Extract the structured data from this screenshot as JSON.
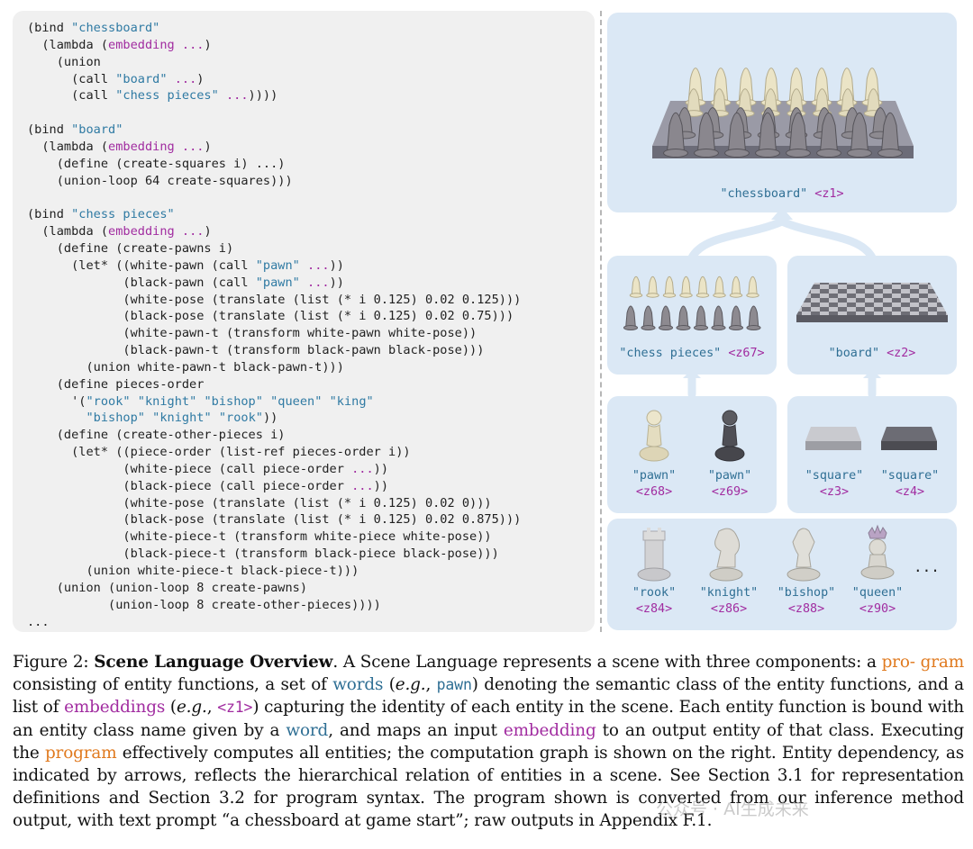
{
  "code": {
    "lines": [
      [
        {
          "t": "(bind "
        },
        {
          "t": "\"chessboard\"",
          "c": "word"
        }
      ],
      [
        {
          "t": "  (lambda ("
        },
        {
          "t": "embedding",
          "c": "emb"
        },
        {
          "t": " "
        },
        {
          "t": "...",
          "c": "emb"
        },
        {
          "t": ")"
        }
      ],
      [
        {
          "t": "    (union"
        }
      ],
      [
        {
          "t": "      (call "
        },
        {
          "t": "\"board\"",
          "c": "word"
        },
        {
          "t": " "
        },
        {
          "t": "...",
          "c": "emb"
        },
        {
          "t": ")"
        }
      ],
      [
        {
          "t": "      (call "
        },
        {
          "t": "\"chess pieces\"",
          "c": "word"
        },
        {
          "t": " "
        },
        {
          "t": "...",
          "c": "emb"
        },
        {
          "t": "))))"
        }
      ],
      [
        {
          "t": ""
        }
      ],
      [
        {
          "t": "(bind "
        },
        {
          "t": "\"board\"",
          "c": "word"
        }
      ],
      [
        {
          "t": "  (lambda ("
        },
        {
          "t": "embedding",
          "c": "emb"
        },
        {
          "t": " "
        },
        {
          "t": "...",
          "c": "emb"
        },
        {
          "t": ")"
        }
      ],
      [
        {
          "t": "    (define (create-squares i) ...)"
        }
      ],
      [
        {
          "t": "    (union-loop 64 create-squares)))"
        }
      ],
      [
        {
          "t": ""
        }
      ],
      [
        {
          "t": "(bind "
        },
        {
          "t": "\"chess pieces\"",
          "c": "word"
        }
      ],
      [
        {
          "t": "  (lambda ("
        },
        {
          "t": "embedding",
          "c": "emb"
        },
        {
          "t": " "
        },
        {
          "t": "...",
          "c": "emb"
        },
        {
          "t": ")"
        }
      ],
      [
        {
          "t": "    (define (create-pawns i)"
        }
      ],
      [
        {
          "t": "      (let* ((white-pawn (call "
        },
        {
          "t": "\"pawn\"",
          "c": "word"
        },
        {
          "t": " "
        },
        {
          "t": "...",
          "c": "emb"
        },
        {
          "t": "))"
        }
      ],
      [
        {
          "t": "             (black-pawn (call "
        },
        {
          "t": "\"pawn\"",
          "c": "word"
        },
        {
          "t": " "
        },
        {
          "t": "...",
          "c": "emb"
        },
        {
          "t": "))"
        }
      ],
      [
        {
          "t": "             (white-pose (translate (list (* i 0.125) 0.02 0.125)))"
        }
      ],
      [
        {
          "t": "             (black-pose (translate (list (* i 0.125) 0.02 0.75)))"
        }
      ],
      [
        {
          "t": "             (white-pawn-t (transform white-pawn white-pose))"
        }
      ],
      [
        {
          "t": "             (black-pawn-t (transform black-pawn black-pose)))"
        }
      ],
      [
        {
          "t": "        (union white-pawn-t black-pawn-t)))"
        }
      ],
      [
        {
          "t": "    (define pieces-order"
        }
      ],
      [
        {
          "t": "      '("
        },
        {
          "t": "\"rook\"",
          "c": "word"
        },
        {
          "t": " "
        },
        {
          "t": "\"knight\"",
          "c": "word"
        },
        {
          "t": " "
        },
        {
          "t": "\"bishop\"",
          "c": "word"
        },
        {
          "t": " "
        },
        {
          "t": "\"queen\"",
          "c": "word"
        },
        {
          "t": " "
        },
        {
          "t": "\"king\"",
          "c": "word"
        }
      ],
      [
        {
          "t": "        "
        },
        {
          "t": "\"bishop\"",
          "c": "word"
        },
        {
          "t": " "
        },
        {
          "t": "\"knight\"",
          "c": "word"
        },
        {
          "t": " "
        },
        {
          "t": "\"rook\"",
          "c": "word"
        },
        {
          "t": "))"
        }
      ],
      [
        {
          "t": "    (define (create-other-pieces i)"
        }
      ],
      [
        {
          "t": "      (let* ((piece-order (list-ref pieces-order i))"
        }
      ],
      [
        {
          "t": "             (white-piece (call piece-order "
        },
        {
          "t": "...",
          "c": "emb"
        },
        {
          "t": "))"
        }
      ],
      [
        {
          "t": "             (black-piece (call piece-order "
        },
        {
          "t": "...",
          "c": "emb"
        },
        {
          "t": "))"
        }
      ],
      [
        {
          "t": "             (white-pose (translate (list (* i 0.125) 0.02 0)))"
        }
      ],
      [
        {
          "t": "             (black-pose (translate (list (* i 0.125) 0.02 0.875)))"
        }
      ],
      [
        {
          "t": "             (white-piece-t (transform white-piece white-pose))"
        }
      ],
      [
        {
          "t": "             (black-piece-t (transform black-piece black-pose)))"
        }
      ],
      [
        {
          "t": "        (union white-piece-t black-piece-t)))"
        }
      ],
      [
        {
          "t": "    (union (union-loop 8 create-pawns)"
        }
      ],
      [
        {
          "t": "           (union-loop 8 create-other-pieces))))"
        }
      ],
      [
        {
          "t": "..."
        }
      ]
    ]
  },
  "graph": {
    "chessboard": {
      "word": "\"chessboard\"",
      "emb": "<z1>"
    },
    "chess_pieces": {
      "word": "\"chess pieces\"",
      "emb": "<z67>"
    },
    "board": {
      "word": "\"board\"",
      "emb": "<z2>"
    },
    "pawn_white": {
      "word": "\"pawn\"",
      "emb": "<z68>"
    },
    "pawn_black": {
      "word": "\"pawn\"",
      "emb": "<z69>"
    },
    "square_light": {
      "word": "\"square\"",
      "emb": "<z3>"
    },
    "square_dark": {
      "word": "\"square\"",
      "emb": "<z4>"
    },
    "rook": {
      "word": "\"rook\"",
      "emb": "<z84>"
    },
    "knight": {
      "word": "\"knight\"",
      "emb": "<z86>"
    },
    "bishop": {
      "word": "\"bishop\"",
      "emb": "<z88>"
    },
    "queen": {
      "word": "\"queen\"",
      "emb": "<z90>"
    },
    "more": "..."
  },
  "caption": {
    "prefix": "Figure 2: ",
    "title": "Scene Language Overview",
    "s1": ". A Scene Language represents a scene with three components: a ",
    "program1": "pro- gram",
    "s2": " consisting of entity functions, a set of ",
    "words1": "words",
    "s3": " (",
    "eg1": "e.g.",
    "s4": ", ",
    "pawn": "pawn",
    "s5": ") denoting the semantic class of the entity functions, and a list of ",
    "embeddings": "embeddings",
    "s6": " (",
    "eg2": "e.g.",
    "s7": ", ",
    "z1": "<z1>",
    "s8": ") capturing the identity of each entity in the scene. Each entity function is bound with an entity class name given by a ",
    "word2": "word",
    "s9": ", and maps an input ",
    "embedding2": "embedding",
    "s10": " to an output entity of that class. Executing the ",
    "program2": "program",
    "s11": " effectively computes all entities; the computation graph is shown on the right. Entity dependency, as indicated by arrows, reflects the hierarchical relation of entities in a scene. See Section 3.1 for representation definitions and Section 3.2 for program syntax. The program shown is converted from our inference method output, with text prompt “a chessboard at game start”; raw outputs in Appendix F.1."
  },
  "watermark": "公众号 · AI生成未来",
  "colors": {
    "word": "#2f7aa3",
    "embedding": "#a12ca0",
    "program": "#e07a1f",
    "panel": "#dbe8f5",
    "code_bg": "#f0f0f0"
  }
}
